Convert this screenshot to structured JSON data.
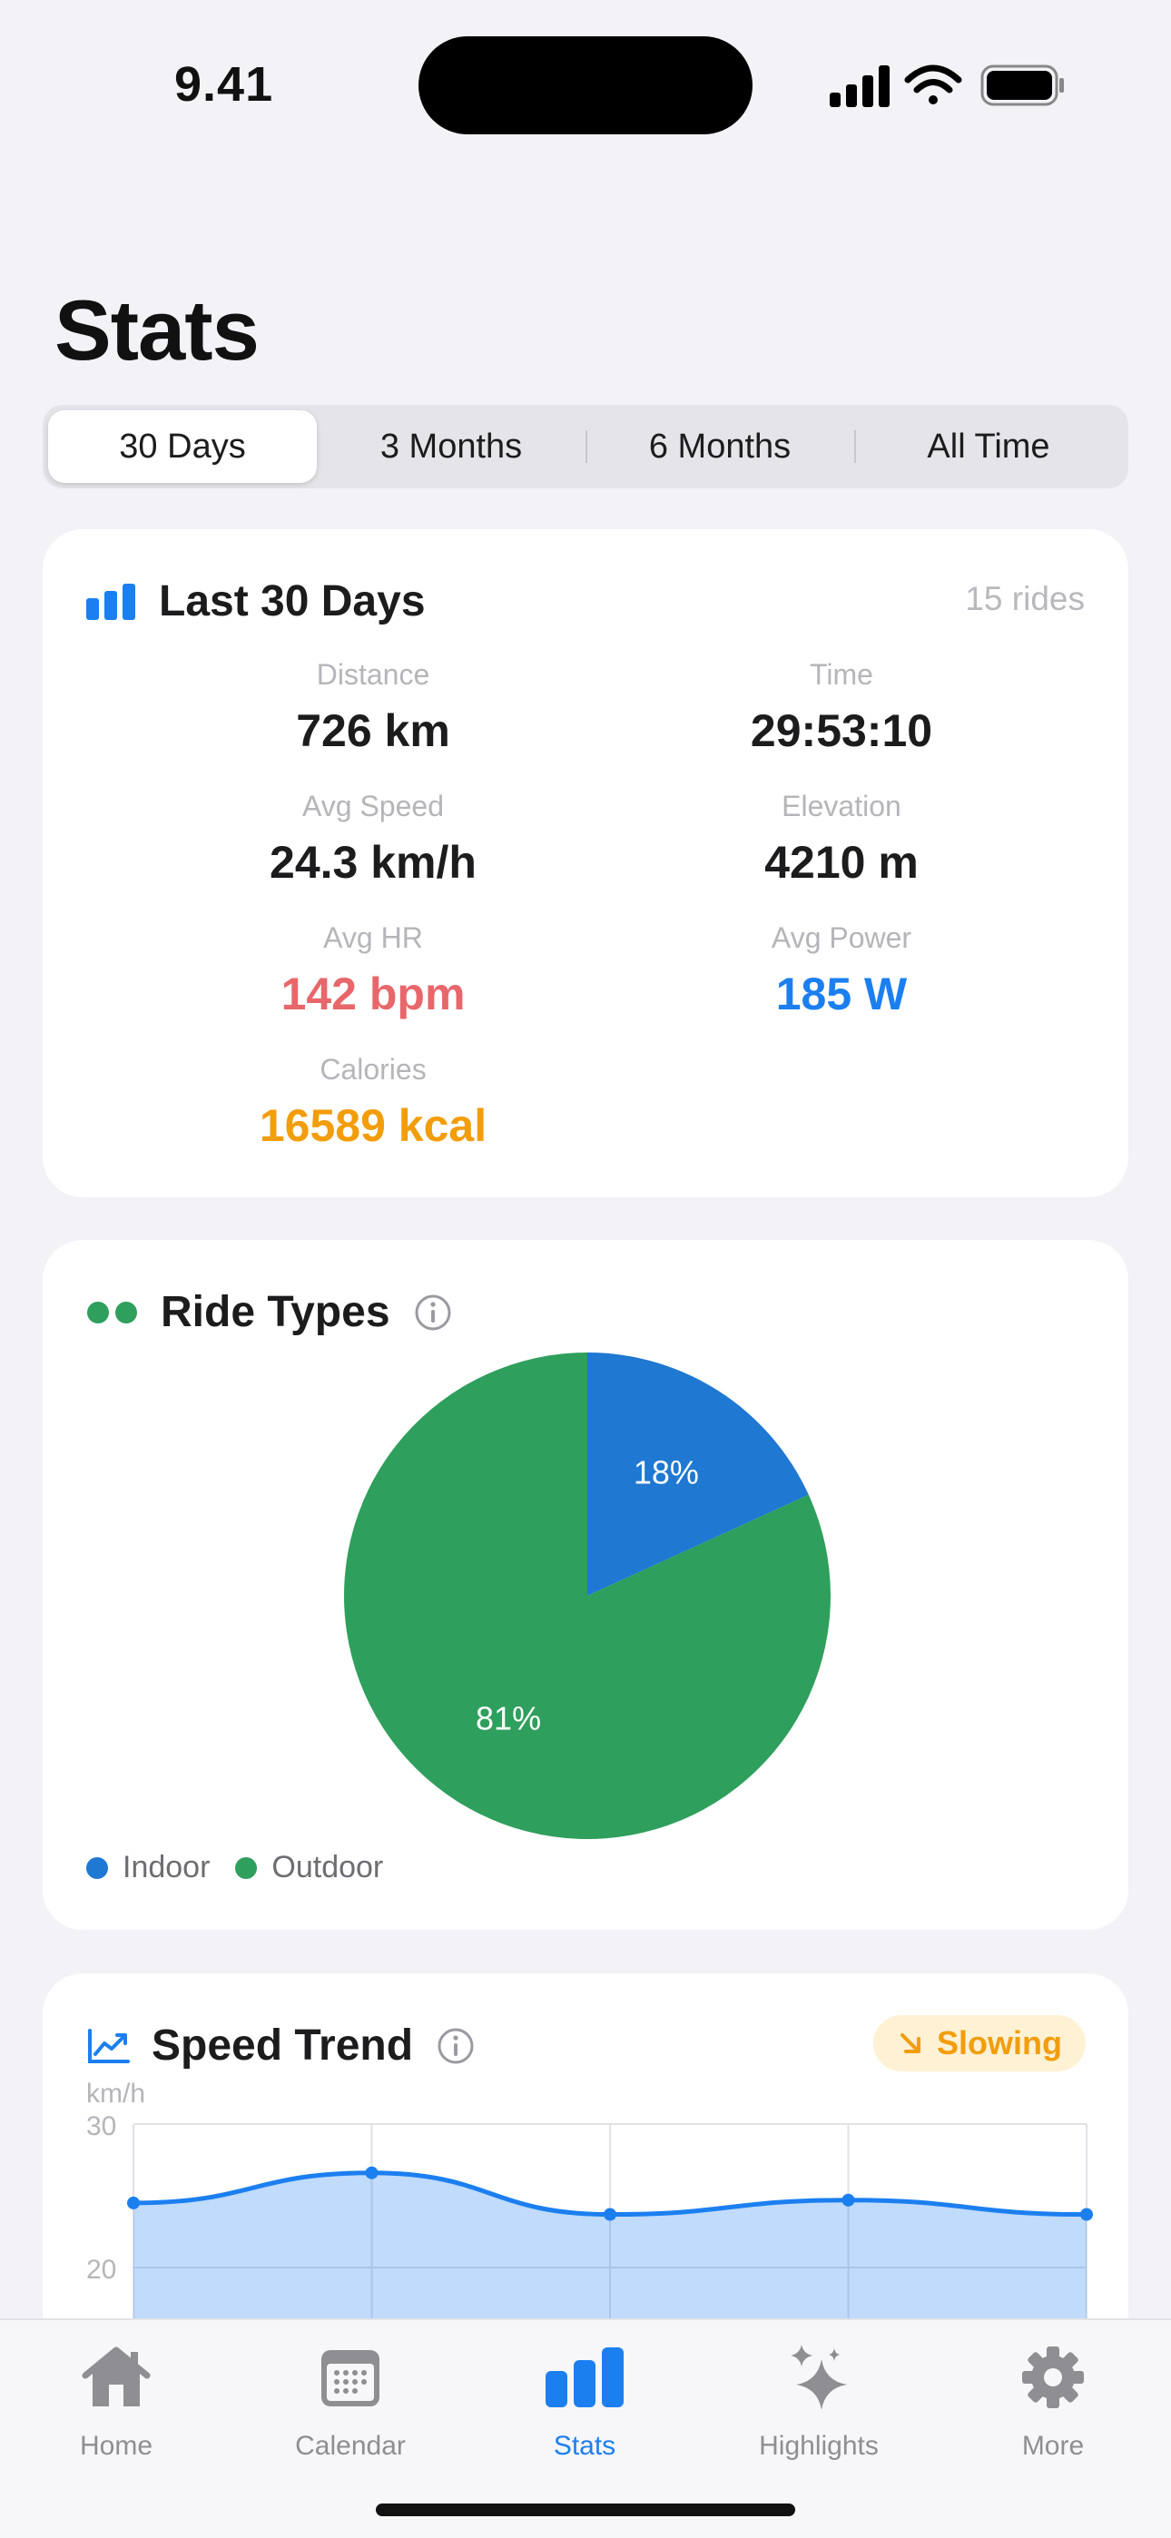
{
  "status_bar": {
    "time": "9.41"
  },
  "page": {
    "title": "Stats"
  },
  "segments": [
    "30 Days",
    "3 Months",
    "6 Months",
    "All Time"
  ],
  "summary": {
    "title": "Last 30 Days",
    "rides": "15 rides",
    "stats": {
      "distance": {
        "label": "Distance",
        "value": "726 km"
      },
      "time": {
        "label": "Time",
        "value": "29:53:10"
      },
      "avg_speed": {
        "label": "Avg Speed",
        "value": "24.3 km/h"
      },
      "elevation": {
        "label": "Elevation",
        "value": "4210 m"
      },
      "avg_hr": {
        "label": "Avg HR",
        "value": "142 bpm"
      },
      "avg_power": {
        "label": "Avg Power",
        "value": "185 W"
      },
      "calories": {
        "label": "Calories",
        "value": "16589 kcal"
      }
    },
    "colors": {
      "hr": "#e8676b",
      "power": "#1c7ff0",
      "calories": "#f29d0a",
      "accent": "#1c7ff0"
    }
  },
  "ride_types": {
    "title": "Ride Types",
    "legend": [
      {
        "name": "Indoor",
        "color": "#1f78d1"
      },
      {
        "name": "Outdoor",
        "color": "#2e9f5c"
      }
    ]
  },
  "speed_trend": {
    "title": "Speed Trend",
    "badge": "Slowing",
    "badge_color": "#f29d0a"
  },
  "chart_data": [
    {
      "type": "pie",
      "categories": [
        "Indoor",
        "Outdoor"
      ],
      "values": [
        18,
        81
      ],
      "labels": [
        "18%",
        "81%"
      ],
      "colors": [
        "#1f78d1",
        "#2e9f5c"
      ],
      "legend_placement": "bottom-left"
    },
    {
      "type": "area",
      "ylabel": "km/h",
      "ylim": [
        20,
        30
      ],
      "yticks": [
        "30",
        "20"
      ],
      "x": [
        0,
        1,
        2,
        3,
        4
      ],
      "values": [
        24.5,
        26.6,
        23.7,
        24.7,
        23.7
      ],
      "grid": true
    }
  ],
  "tabs": [
    {
      "label": "Home",
      "icon": "house-icon"
    },
    {
      "label": "Calendar",
      "icon": "calendar-icon"
    },
    {
      "label": "Stats",
      "icon": "bar-chart-icon",
      "active": true
    },
    {
      "label": "Highlights",
      "icon": "sparkles-icon"
    },
    {
      "label": "More",
      "icon": "gear-icon"
    }
  ]
}
